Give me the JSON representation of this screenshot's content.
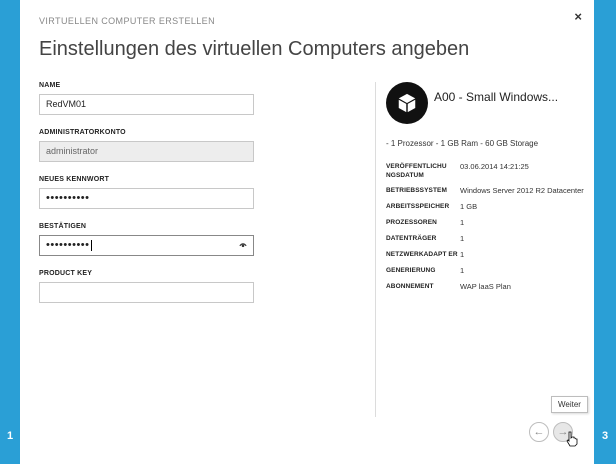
{
  "steps": {
    "left": "1",
    "right": "3"
  },
  "close_glyph": "×",
  "breadcrumb": "VIRTUELLEN COMPUTER ERSTELLEN",
  "title": "Einstellungen des virtuellen Computers angeben",
  "form": {
    "name_label": "NAME",
    "name_value": "RedVM01",
    "admin_label": "ADMINISTRATORKONTO",
    "admin_value": "administrator",
    "new_password_label": "NEUES KENNWORT",
    "new_password_value": "••••••••••",
    "confirm_label": "BESTÄTIGEN",
    "confirm_value": "••••••••••",
    "product_key_label": "PRODUCT KEY",
    "product_key_value": ""
  },
  "details": {
    "tile_icon": "box-icon",
    "tile_title": "A00 - Small Windows...",
    "summary": "- 1 Prozessor - 1 GB Ram - 60 GB Storage",
    "properties": [
      {
        "key": "VERÖFFENTLICHU NGSDATUM",
        "value": "03.06.2014 14:21:25"
      },
      {
        "key": "BETRIEBSSYSTEM",
        "value": "Windows Server 2012 R2 Datacenter"
      },
      {
        "key": "ARBEITSSPEICHER",
        "value": "1 GB"
      },
      {
        "key": "PROZESSOREN",
        "value": "1"
      },
      {
        "key": "DATENTRÄGER",
        "value": "1"
      },
      {
        "key": "NETZWERKADAPT ER",
        "value": "1"
      },
      {
        "key": "GENERIERUNG",
        "value": "1"
      },
      {
        "key": "ABONNEMENT",
        "value": "WAP laaS Plan"
      }
    ]
  },
  "nav": {
    "tooltip": "Weiter",
    "back_glyph": "←",
    "next_glyph": "→"
  },
  "colors": {
    "accent": "#2a9fd6"
  }
}
